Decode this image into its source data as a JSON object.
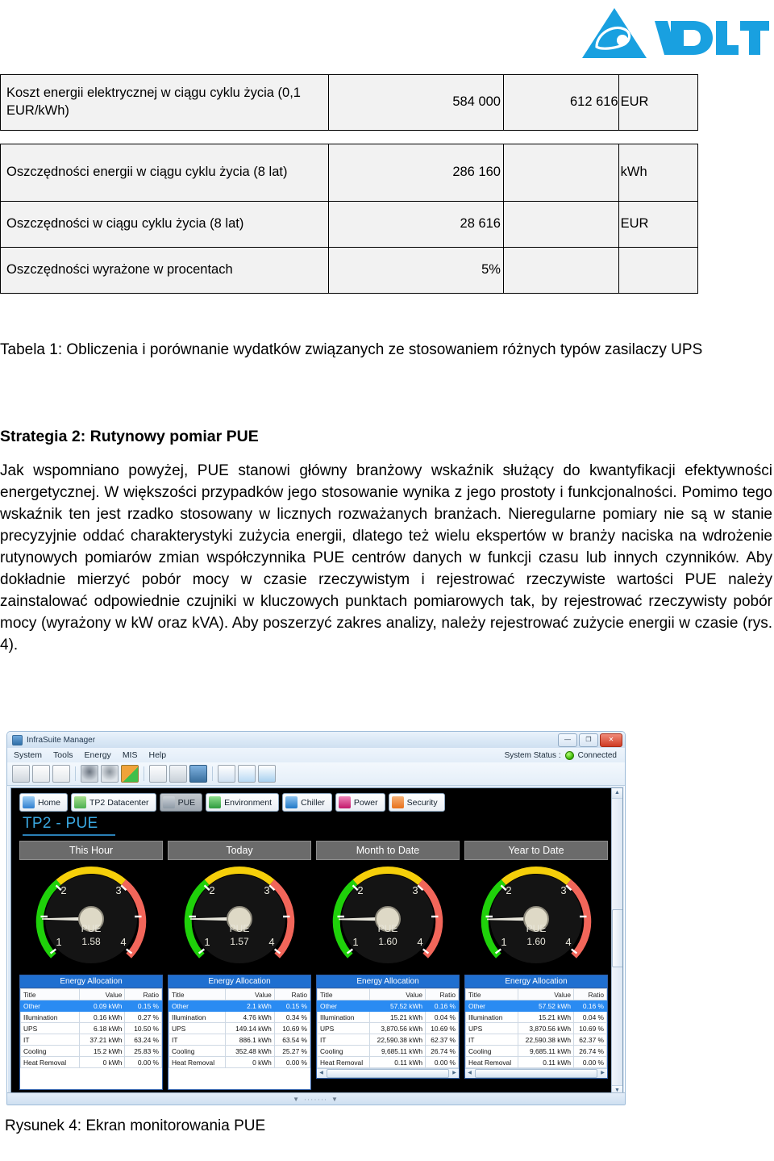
{
  "brand": {
    "name": "DELTA",
    "logo_color": "#19a0e0",
    "icon": "delta-triangle-logo"
  },
  "cost_table": {
    "rows": [
      {
        "label": "Koszt energii elektrycznej w ciągu cyklu życia (0,1 EUR/kWh)",
        "value_a": "584 000",
        "value_b": "612 616",
        "unit": "EUR"
      },
      {
        "label": "Oszczędności energii w ciągu cyklu życia (8 lat)",
        "value_a": "286 160",
        "value_b": "",
        "unit": "kWh"
      },
      {
        "label": "Oszczędności w ciągu cyklu życia (8 lat)",
        "value_a": "28 616",
        "value_b": "",
        "unit": "EUR"
      },
      {
        "label": "Oszczędności wyrażone w procentach",
        "value_a": "5%",
        "value_b": "",
        "unit": ""
      }
    ]
  },
  "table_caption": "Tabela 1: Obliczenia i porównanie wydatków związanych ze stosowaniem różnych typów zasilaczy UPS",
  "section_heading": "Strategia 2: Rutynowy pomiar PUE",
  "body_text": "Jak wspomniano powyżej, PUE stanowi główny branżowy wskaźnik służący do kwantyfikacji efektywności energetycznej. W większości przypadków jego stosowanie wynika z jego prostoty i funkcjonalności. Pomimo tego wskaźnik ten jest rzadko stosowany w licznych rozważanych branżach. Nieregularne pomiary nie są w stanie precyzyjnie oddać charakterystyki zużycia energii, dlatego też wielu ekspertów w branży naciska na wdrożenie rutynowych pomiarów zmian współczynnika PUE centrów danych w funkcji czasu lub innych czynników. Aby dokładnie mierzyć pobór mocy w czasie rzeczywistym i rejestrować rzeczywiste wartości PUE należy zainstalować odpowiednie czujniki w kluczowych punktach pomiarowych tak, by rejestrować rzeczywisty pobór mocy (wyrażony w kW oraz kVA). Aby poszerzyć zakres analizy, należy rejestrować zużycie energii w czasie (rys. 4).",
  "figure_caption": "Rysunek 4: Ekran monitorowania PUE",
  "app": {
    "window_title": "InfraSuite Manager",
    "window_buttons": {
      "minimize": "—",
      "maximize": "❐",
      "close": "✕"
    },
    "menu": [
      "System",
      "Tools",
      "Energy",
      "MIS",
      "Help"
    ],
    "status_label": "System Status :",
    "status_value": "Connected",
    "status_color": "#35b400",
    "toolbar_icons": [
      "log-icon",
      "bar-chart-icon",
      "report-chart-icon",
      "device-icon",
      "device-search-icon",
      "export-icon",
      "notes-icon",
      "tools-icon",
      "network-icon",
      "page-icon",
      "refresh-page-icon",
      "refresh-pages-icon"
    ],
    "tabs": [
      {
        "label": "Home",
        "icon": "home-icon",
        "color": "#2f7fd0",
        "selected": false
      },
      {
        "label": "TP2 Datacenter",
        "icon": "datacenter-icon",
        "color": "#4caf50",
        "selected": false
      },
      {
        "label": "PUE",
        "icon": "pue-icon",
        "color": "#8e9aa6",
        "selected": true
      },
      {
        "label": "Environment",
        "icon": "environment-icon",
        "color": "#2e9b3f",
        "selected": false
      },
      {
        "label": "Chiller",
        "icon": "chiller-icon",
        "color": "#1f78c8",
        "selected": false
      },
      {
        "label": "Power",
        "icon": "power-icon",
        "color": "#c2186b",
        "selected": false
      },
      {
        "label": "Security",
        "icon": "security-icon",
        "color": "#e8711c",
        "selected": false
      }
    ],
    "page_title": "TP2 - PUE",
    "columns": [
      {
        "header": "This Hour",
        "gauge": {
          "label": "PUE",
          "value": "1.58",
          "numeric": 1.58,
          "min": 1,
          "max": 4,
          "ticks": [
            "1",
            "2",
            "3",
            "4"
          ]
        },
        "alloc_title": "Energy Allocation",
        "alloc_headers": [
          "Title",
          "Value",
          "Ratio"
        ],
        "alloc_rows": [
          {
            "title": "Other",
            "value": "0.09 kWh",
            "ratio": "0.15 %",
            "selected": true
          },
          {
            "title": "Illumination",
            "value": "0.16 kWh",
            "ratio": "0.27 %",
            "selected": false
          },
          {
            "title": "UPS",
            "value": "6.18 kWh",
            "ratio": "10.50 %",
            "selected": false
          },
          {
            "title": "IT",
            "value": "37.21 kWh",
            "ratio": "63.24 %",
            "selected": false
          },
          {
            "title": "Cooling",
            "value": "15.2 kWh",
            "ratio": "25.83 %",
            "selected": false
          },
          {
            "title": "Heat Removal",
            "value": "0 kWh",
            "ratio": "0.00 %",
            "selected": false
          }
        ],
        "has_hscroll": false
      },
      {
        "header": "Today",
        "gauge": {
          "label": "PUE",
          "value": "1.57",
          "numeric": 1.57,
          "min": 1,
          "max": 4,
          "ticks": [
            "1",
            "2",
            "3",
            "4"
          ]
        },
        "alloc_title": "Energy Allocation",
        "alloc_headers": [
          "Title",
          "Value",
          "Ratio"
        ],
        "alloc_rows": [
          {
            "title": "Other",
            "value": "2.1 kWh",
            "ratio": "0.15 %",
            "selected": true
          },
          {
            "title": "Illumination",
            "value": "4.76 kWh",
            "ratio": "0.34 %",
            "selected": false
          },
          {
            "title": "UPS",
            "value": "149.14 kWh",
            "ratio": "10.69 %",
            "selected": false
          },
          {
            "title": "IT",
            "value": "886.1 kWh",
            "ratio": "63.54 %",
            "selected": false
          },
          {
            "title": "Cooling",
            "value": "352.48 kWh",
            "ratio": "25.27 %",
            "selected": false
          },
          {
            "title": "Heat Removal",
            "value": "0 kWh",
            "ratio": "0.00 %",
            "selected": false
          }
        ],
        "has_hscroll": false
      },
      {
        "header": "Month to Date",
        "gauge": {
          "label": "PUE",
          "value": "1.60",
          "numeric": 1.6,
          "min": 1,
          "max": 4,
          "ticks": [
            "1",
            "2",
            "3",
            "4"
          ]
        },
        "alloc_title": "Energy Allocation",
        "alloc_headers": [
          "Title",
          "Value",
          "Ratio"
        ],
        "alloc_rows": [
          {
            "title": "Other",
            "value": "57.52 kWh",
            "ratio": "0.16 %",
            "selected": true
          },
          {
            "title": "Illumination",
            "value": "15.21 kWh",
            "ratio": "0.04 %",
            "selected": false
          },
          {
            "title": "UPS",
            "value": "3,870.56 kWh",
            "ratio": "10.69 %",
            "selected": false
          },
          {
            "title": "IT",
            "value": "22,590.38 kWh",
            "ratio": "62.37 %",
            "selected": false
          },
          {
            "title": "Cooling",
            "value": "9,685.11 kWh",
            "ratio": "26.74 %",
            "selected": false
          },
          {
            "title": "Heat Removal",
            "value": "0.11 kWh",
            "ratio": "0.00 %",
            "selected": false
          }
        ],
        "has_hscroll": true
      },
      {
        "header": "Year to Date",
        "gauge": {
          "label": "PUE",
          "value": "1.60",
          "numeric": 1.6,
          "min": 1,
          "max": 4,
          "ticks": [
            "1",
            "2",
            "3",
            "4"
          ]
        },
        "alloc_title": "Energy Allocation",
        "alloc_headers": [
          "Title",
          "Value",
          "Ratio"
        ],
        "alloc_rows": [
          {
            "title": "Other",
            "value": "57.52 kWh",
            "ratio": "0.16 %",
            "selected": true
          },
          {
            "title": "Illumination",
            "value": "15.21 kWh",
            "ratio": "0.04 %",
            "selected": false
          },
          {
            "title": "UPS",
            "value": "3,870.56 kWh",
            "ratio": "10.69 %",
            "selected": false
          },
          {
            "title": "IT",
            "value": "22,590.38 kWh",
            "ratio": "62.37 %",
            "selected": false
          },
          {
            "title": "Cooling",
            "value": "9,685.11 kWh",
            "ratio": "26.74 %",
            "selected": false
          },
          {
            "title": "Heat Removal",
            "value": "0.11 kWh",
            "ratio": "0.00 %",
            "selected": false
          }
        ],
        "has_hscroll": true
      }
    ],
    "gauge_colors": {
      "green": "#1fd10a",
      "yellow": "#f5cf0a",
      "red": "#f2665a",
      "face": "#141414",
      "needle": "#e9e7dc"
    }
  }
}
